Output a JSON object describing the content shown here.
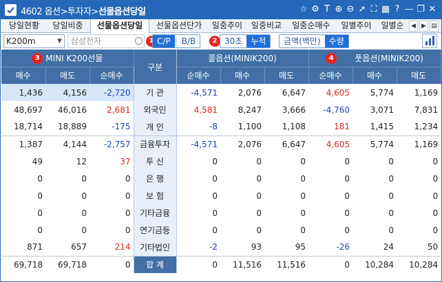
{
  "window": {
    "code": "4602",
    "breadcrumb": "옵션>투자자>",
    "title_bold": "선물옵션당일"
  },
  "title_icons": [
    "star-icon",
    "settings-icon",
    "text-size-icon",
    "zoom-in-icon",
    "zoom-out-icon",
    "share-icon",
    "capture-icon",
    "columns-icon",
    "help-icon",
    "minimize-icon",
    "restore-icon",
    "close-icon"
  ],
  "tabs": [
    "당일현황",
    "당일비중",
    "선물옵션당일",
    "선물옵션단가",
    "일중추이",
    "일중비교",
    "일중순매수",
    "일별추이",
    "일별순"
  ],
  "active_tab": 2,
  "toolbar": {
    "product": "K200m",
    "stock_placeholder": "삼성전자",
    "seg1": [
      "C/P",
      "B/B"
    ],
    "seg1_active": 0,
    "seg2": [
      "30초",
      "누적"
    ],
    "seg2_active": 1,
    "seg3": [
      "금액(백만)",
      "수량"
    ],
    "seg3_active": 1
  },
  "annotations": [
    "1",
    "2",
    "3",
    "4"
  ],
  "table": {
    "group_futures": "MINI K200선물",
    "group_gubun": "구분",
    "group_call": "콜옵션(MINIK200)",
    "group_put": "풋옵션(MINIK200)",
    "col_headers": [
      "매수",
      "매도",
      "순매수",
      "순매수",
      "매수",
      "매도",
      "순매수",
      "매수",
      "매도"
    ],
    "rows": [
      {
        "label": "기  관",
        "f": [
          "1,436",
          "4,156",
          "-2,720"
        ],
        "c": [
          "-4,571",
          "2,076",
          "6,647"
        ],
        "p": [
          "4,605",
          "5,774",
          "1,169"
        ]
      },
      {
        "label": "외국인",
        "f": [
          "48,697",
          "46,016",
          "2,681"
        ],
        "c": [
          "4,581",
          "8,247",
          "3,666"
        ],
        "p": [
          "-4,760",
          "3,071",
          "7,831"
        ]
      },
      {
        "label": "개  인",
        "f": [
          "18,714",
          "18,889",
          "-175"
        ],
        "c": [
          "-8",
          "1,100",
          "1,108"
        ],
        "p": [
          "181",
          "1,415",
          "1,234"
        ]
      },
      {
        "label": "금융투자",
        "f": [
          "1,387",
          "4,144",
          "-2,757"
        ],
        "c": [
          "-4,571",
          "2,076",
          "6,647"
        ],
        "p": [
          "4,605",
          "5,774",
          "1,169"
        ]
      },
      {
        "label": "투  신",
        "f": [
          "49",
          "12",
          "37"
        ],
        "c": [
          "0",
          "0",
          "0"
        ],
        "p": [
          "0",
          "0",
          "0"
        ]
      },
      {
        "label": "은  행",
        "f": [
          "0",
          "0",
          "0"
        ],
        "c": [
          "0",
          "0",
          "0"
        ],
        "p": [
          "0",
          "0",
          "0"
        ]
      },
      {
        "label": "보  험",
        "f": [
          "0",
          "0",
          "0"
        ],
        "c": [
          "0",
          "0",
          "0"
        ],
        "p": [
          "0",
          "0",
          "0"
        ]
      },
      {
        "label": "기타금융",
        "f": [
          "0",
          "0",
          "0"
        ],
        "c": [
          "0",
          "0",
          "0"
        ],
        "p": [
          "0",
          "0",
          "0"
        ]
      },
      {
        "label": "연기금등",
        "f": [
          "0",
          "0",
          "0"
        ],
        "c": [
          "0",
          "0",
          "0"
        ],
        "p": [
          "0",
          "0",
          "0"
        ]
      },
      {
        "label": "기타법인",
        "f": [
          "871",
          "657",
          "214"
        ],
        "c": [
          "-2",
          "93",
          "95"
        ],
        "p": [
          "-26",
          "24",
          "50"
        ]
      },
      {
        "label": "합  계",
        "f": [
          "69,718",
          "69,718",
          "0"
        ],
        "c": [
          "0",
          "11,516",
          "11,516"
        ],
        "p": [
          "0",
          "10,284",
          "10,284"
        ]
      }
    ]
  },
  "colors": {
    "titlebar": "#2567b8",
    "header": "#416fa6",
    "negative": "#1e3fbf",
    "positive": "#d42a1f",
    "badge": "#e8231f"
  }
}
